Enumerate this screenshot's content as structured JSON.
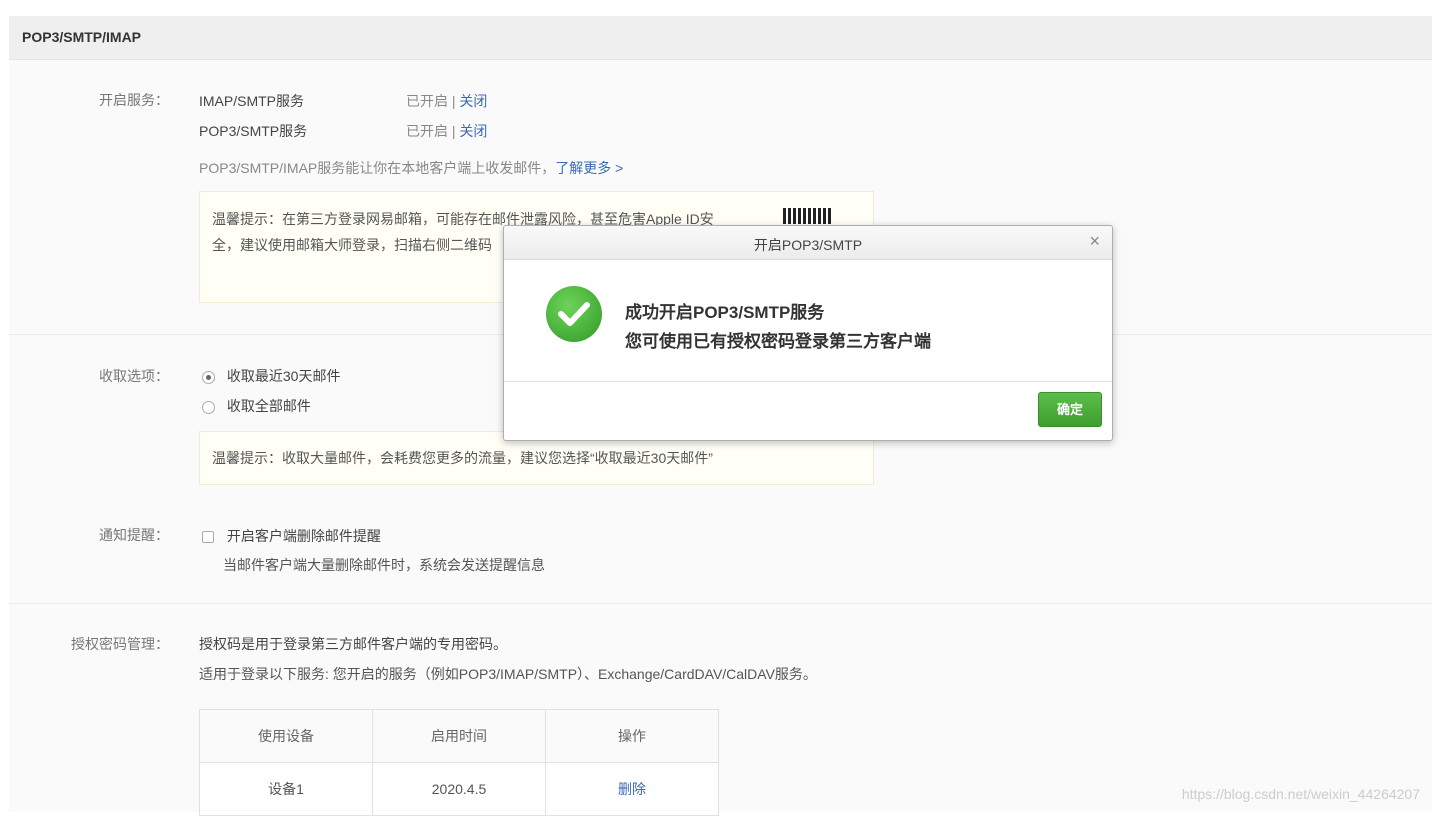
{
  "header": {
    "title": "POP3/SMTP/IMAP"
  },
  "service": {
    "label": "开启服务：",
    "items": [
      {
        "name": "IMAP/SMTP服务",
        "status": "已开启",
        "sep": "|",
        "action": "关闭"
      },
      {
        "name": "POP3/SMTP服务",
        "status": "已开启",
        "sep": "|",
        "action": "关闭"
      }
    ],
    "desc": "POP3/SMTP/IMAP服务能让你在本地客户端上收发邮件，",
    "learn_more": "了解更多 >",
    "tip_line1": "温馨提示：在第三方登录网易邮箱，可能存在邮件泄露风险，甚至危害Apple ID安",
    "tip_line2": "全，建议使用邮箱大师登录，扫描右侧二维码"
  },
  "fetch": {
    "label": "收取选项：",
    "options": [
      "收取最近30天邮件",
      "收取全部邮件"
    ],
    "tip": "温馨提示：收取大量邮件，会耗费您更多的流量，建议您选择“收取最近30天邮件”"
  },
  "notify": {
    "label": "通知提醒：",
    "checkbox_label": "开启客户端删除邮件提醒",
    "desc": "当邮件客户端大量删除邮件时，系统会发送提醒信息"
  },
  "auth": {
    "label": "授权密码管理：",
    "desc1": "授权码是用于登录第三方邮件客户端的专用密码。",
    "desc2": "适用于登录以下服务: 您开启的服务（例如POP3/IMAP/SMTP）、Exchange/CardDAV/CalDAV服务。",
    "columns": [
      "使用设备",
      "启用时间",
      "操作"
    ],
    "rows": [
      {
        "device": "设备1",
        "date": "2020.4.5",
        "action": "删除"
      }
    ]
  },
  "modal": {
    "title": "开启POP3/SMTP",
    "close": "×",
    "line1": "成功开启POP3/SMTP服务",
    "line2": "您可使用已有授权密码登录第三方客户端",
    "ok": "确定"
  },
  "watermark": "https://blog.csdn.net/weixin_44264207"
}
